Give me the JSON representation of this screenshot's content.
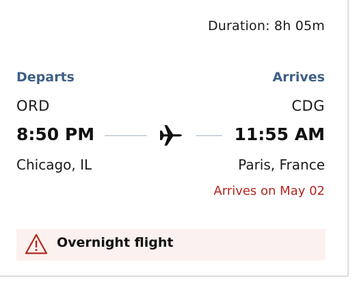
{
  "duration": "Duration: 8h 05m",
  "departure": {
    "label": "Departs",
    "code": "ORD",
    "time": "8:50 PM",
    "city": "Chicago, IL"
  },
  "arrival": {
    "label": "Arrives",
    "code": "CDG",
    "time": "11:55 AM",
    "city": "Paris, France",
    "arrives_on": "Arrives on May 02"
  },
  "alert": {
    "icon": "warning-icon",
    "text": "Overnight flight"
  },
  "icons": {
    "route": "airplane-icon"
  },
  "colors": {
    "label_blue": "#3f5f86",
    "alert_red": "#b3261e",
    "alert_bg": "#fbf1ee",
    "route_line": "#a8b6c4"
  }
}
